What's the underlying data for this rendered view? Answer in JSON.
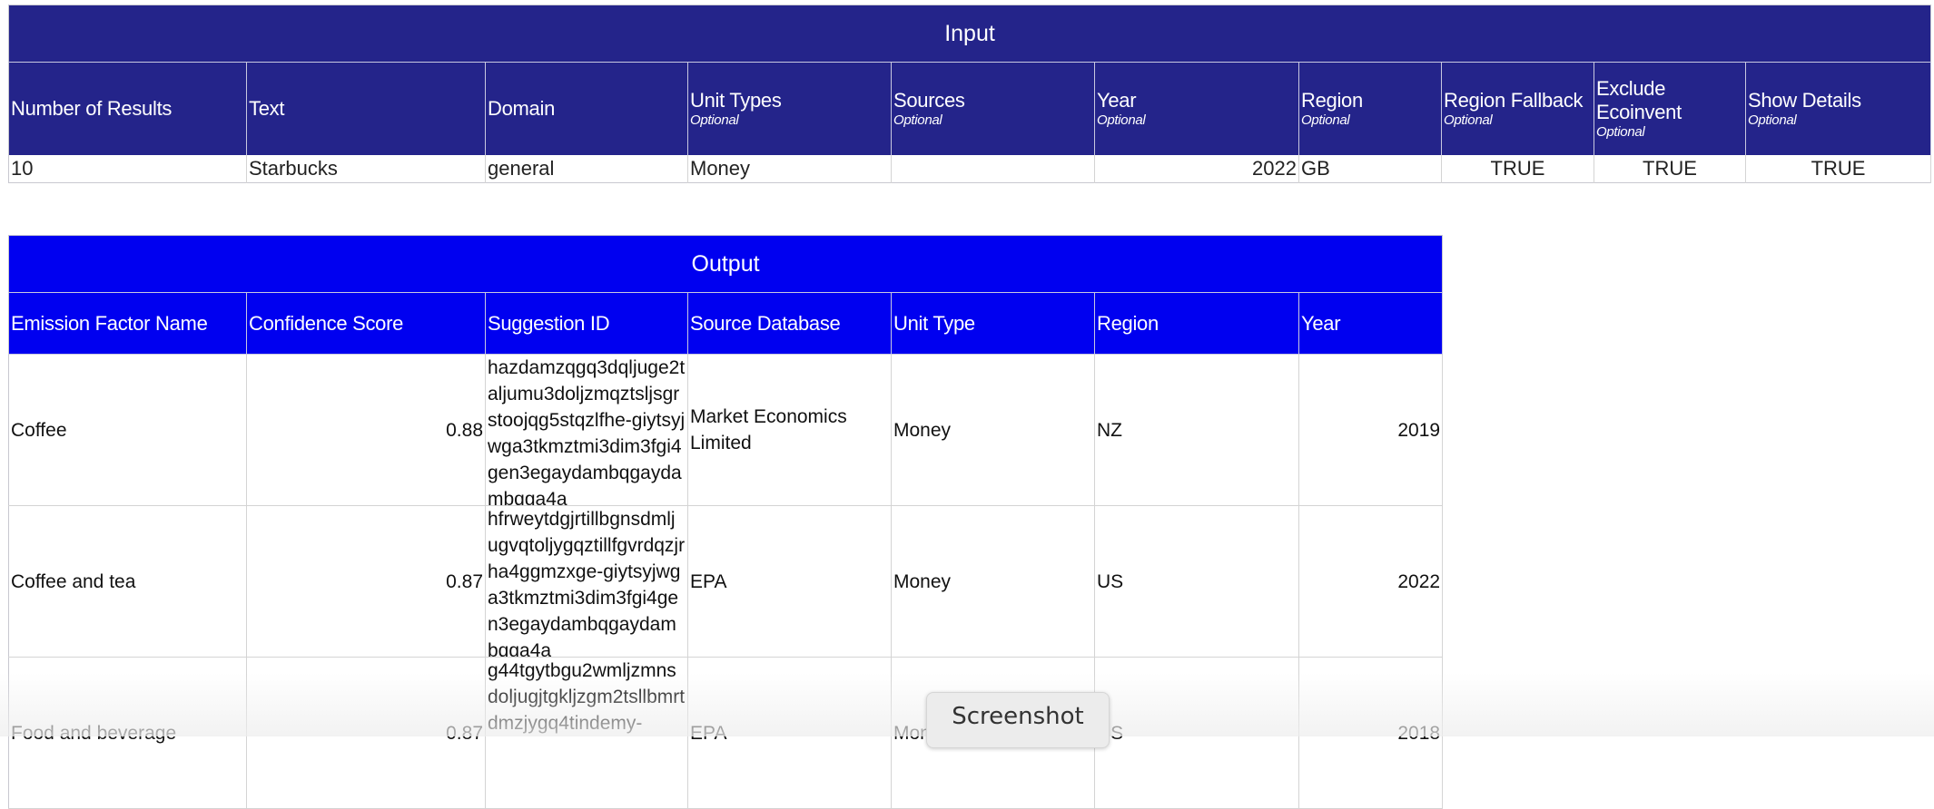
{
  "input": {
    "title": "Input",
    "headers": [
      {
        "label": "Number of Results",
        "sub": ""
      },
      {
        "label": "Text",
        "sub": ""
      },
      {
        "label": "Domain",
        "sub": ""
      },
      {
        "label": "Unit Types",
        "sub": "Optional"
      },
      {
        "label": "Sources",
        "sub": "Optional"
      },
      {
        "label": "Year",
        "sub": "Optional"
      },
      {
        "label": "Region",
        "sub": "Optional"
      },
      {
        "label": "Region Fallback",
        "sub": "Optional"
      },
      {
        "label": "Exclude Ecoinvent",
        "sub": "Optional"
      },
      {
        "label": "Show Details",
        "sub": "Optional"
      }
    ],
    "values": [
      "10",
      "Starbucks",
      "general",
      "Money",
      "",
      "2022",
      "GB",
      "TRUE",
      "TRUE",
      "TRUE"
    ]
  },
  "output": {
    "title": "Output",
    "headers": [
      "Emission Factor Name",
      "Confidence Score",
      "Suggestion ID",
      "Source Database",
      "Unit Type",
      "Region",
      "Year"
    ],
    "rows": [
      {
        "name": "Coffee",
        "confidence": "0.88",
        "suggestion_id": "hazdamzqgq3dqljuge2taljumu3doljzmqztsljsgrstoojqg5stqzlfhe-giytsyjwga3tkmztmi3dim3fgi4gen3egaydambqgaydambqga4a",
        "source": "Market Economics Limited",
        "unit_type": "Money",
        "region": "NZ",
        "year": "2019"
      },
      {
        "name": "Coffee and tea",
        "confidence": "0.87",
        "suggestion_id": "hfrweytdgjrtillbgnsdmljugvqtoljygqztillfgvrdqzjrha4ggmzxge-giytsyjwga3tkmztmi3dim3fgi4gen3egaydambqgaydambqga4a",
        "source": "EPA",
        "unit_type": "Money",
        "region": "US",
        "year": "2022"
      },
      {
        "name": "Food and beverage",
        "confidence": "0.87",
        "suggestion_id": "g44tgytbgu2wmljzmnsdoljugjtgkljzgm2tsllbmrtdmzjygq4tindemy-",
        "source": "EPA",
        "unit_type": "Money",
        "region": "US",
        "year": "2018"
      }
    ]
  },
  "tooltip": {
    "label": "Screenshot"
  },
  "colors": {
    "input_header_bg": "#24248a",
    "output_header_bg": "#0000f0",
    "header_text": "#ffffff"
  }
}
